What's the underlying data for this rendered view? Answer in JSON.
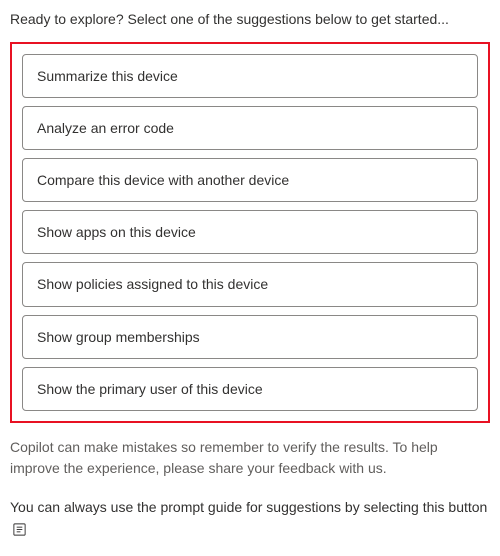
{
  "intro": "Ready to explore? Select one of the suggestions below to get started...",
  "suggestions": {
    "items": [
      {
        "label": "Summarize this device"
      },
      {
        "label": "Analyze an error code"
      },
      {
        "label": "Compare this device with another device"
      },
      {
        "label": "Show apps on this device"
      },
      {
        "label": "Show policies assigned to this device"
      },
      {
        "label": "Show group memberships"
      },
      {
        "label": "Show the primary user of this device"
      }
    ]
  },
  "disclaimer": "Copilot can make mistakes so remember to verify the results. To help improve the experience, please share your feedback with us.",
  "guide": {
    "text_before": "You can always use the prompt guide for suggestions by selecting this button"
  }
}
